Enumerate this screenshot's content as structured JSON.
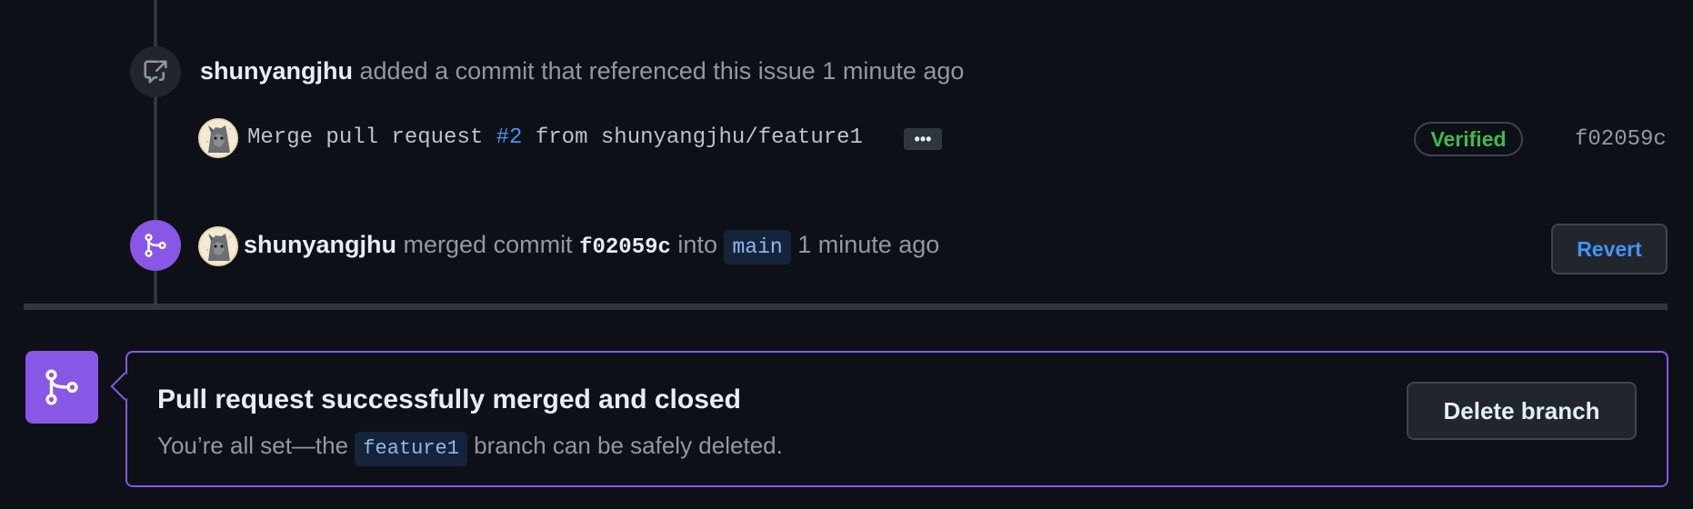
{
  "events": [
    {
      "type": "commit-reference",
      "actor": "shunyangjhu",
      "text": "added a commit that referenced this issue",
      "time": "1 minute ago",
      "commit": {
        "message_prefix": "Merge pull request",
        "pr_link": "#2",
        "message_suffix": "from shunyangjhu/feature1",
        "ellipsis": "•••",
        "verified_label": "Verified",
        "sha": "f02059c"
      }
    },
    {
      "type": "merged",
      "actor": "shunyangjhu",
      "text_merged": "merged commit",
      "sha": "f02059c",
      "text_into": "into",
      "branch": "main",
      "time": "1 minute ago",
      "revert_label": "Revert"
    }
  ],
  "merged_box": {
    "title": "Pull request successfully merged and closed",
    "desc_prefix": "You’re all set—the",
    "branch": "feature1",
    "desc_suffix": "branch can be safely deleted.",
    "delete_button_label": "Delete branch"
  },
  "icons": {
    "reference": "cross-reference-icon",
    "merge": "git-merge-icon",
    "avatar": "user-avatar"
  },
  "colors": {
    "background": "#0d1117",
    "merge_purple": "#8957e5",
    "link_blue": "#4493f8",
    "verified_green": "#3fb950"
  }
}
